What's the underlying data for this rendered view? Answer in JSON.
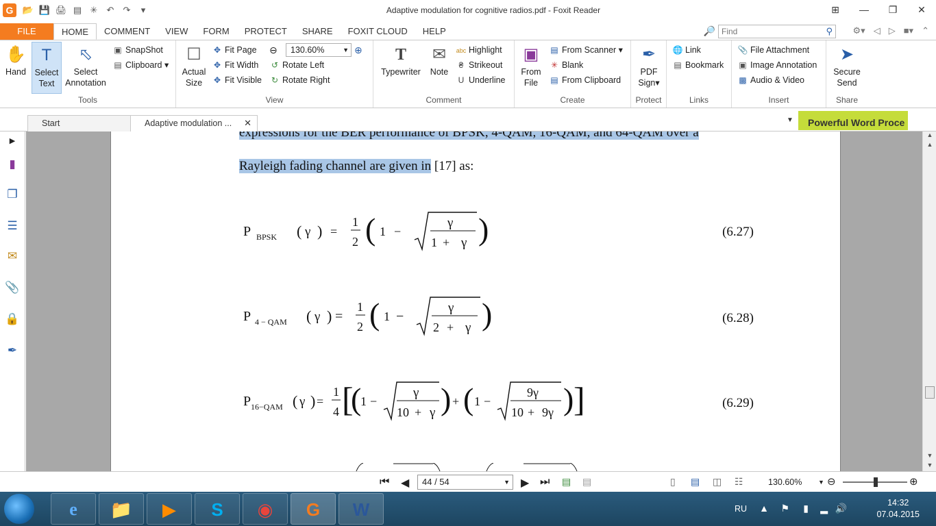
{
  "window": {
    "title": "Adaptive modulation for cognitive radios.pdf - Foxit Reader",
    "app_logo": "G"
  },
  "ribbon_tabs": [
    "FILE",
    "HOME",
    "COMMENT",
    "VIEW",
    "FORM",
    "PROTECT",
    "SHARE",
    "FOXIT CLOUD",
    "HELP"
  ],
  "active_tab": "HOME",
  "find": {
    "placeholder": "Find"
  },
  "ribbon": {
    "tools": {
      "label": "Tools",
      "hand": "Hand",
      "select_text_1": "Select",
      "select_text_2": "Text",
      "select_annotation_1": "Select",
      "select_annotation_2": "Annotation",
      "snapshot": "SnapShot",
      "clipboard": "Clipboard"
    },
    "view": {
      "label": "View",
      "actual_size_1": "Actual",
      "actual_size_2": "Size",
      "fit_page": "Fit Page",
      "fit_width": "Fit Width",
      "fit_visible": "Fit Visible",
      "zoom_value": "130.60%",
      "rotate_left": "Rotate Left",
      "rotate_right": "Rotate Right"
    },
    "comment": {
      "label": "Comment",
      "typewriter": "Typewriter",
      "note": "Note",
      "highlight": "Highlight",
      "strikeout": "Strikeout",
      "underline": "Underline"
    },
    "create": {
      "label": "Create",
      "from_file_1": "From",
      "from_file_2": "File",
      "from_scanner": "From Scanner",
      "blank": "Blank",
      "from_clipboard": "From Clipboard"
    },
    "protect": {
      "label": "Protect",
      "pdf_sign_1": "PDF",
      "pdf_sign_2": "Sign"
    },
    "links": {
      "label": "Links",
      "link": "Link",
      "bookmark": "Bookmark"
    },
    "insert": {
      "label": "Insert",
      "file_attachment": "File Attachment",
      "image_annotation": "Image Annotation",
      "audio_video": "Audio & Video"
    },
    "share": {
      "label": "Share",
      "secure_send_1": "Secure",
      "secure_send_2": "Send"
    }
  },
  "doc_tabs": {
    "start": "Start",
    "current": "Adaptive modulation ...",
    "promo": "Powerful Word Proce"
  },
  "document": {
    "line1": "expressions for the BER performance of BPSK, 4-QAM, 16-QAM, and 64-QAM over a",
    "line2_hl": "Rayleigh fading channel are given in",
    "line2_rest": " [17] as:",
    "equations": [
      {
        "number": "(6.27)",
        "subscript": "BPSK"
      },
      {
        "number": "(6.28)",
        "subscript": "4 − QAM"
      },
      {
        "number": "(6.29)",
        "subscript": "16−QAM"
      }
    ]
  },
  "status": {
    "page": "44 / 54",
    "zoom": "130.60%"
  },
  "taskbar": {
    "lang": "RU",
    "time": "14:32",
    "date": "07.04.2015"
  }
}
